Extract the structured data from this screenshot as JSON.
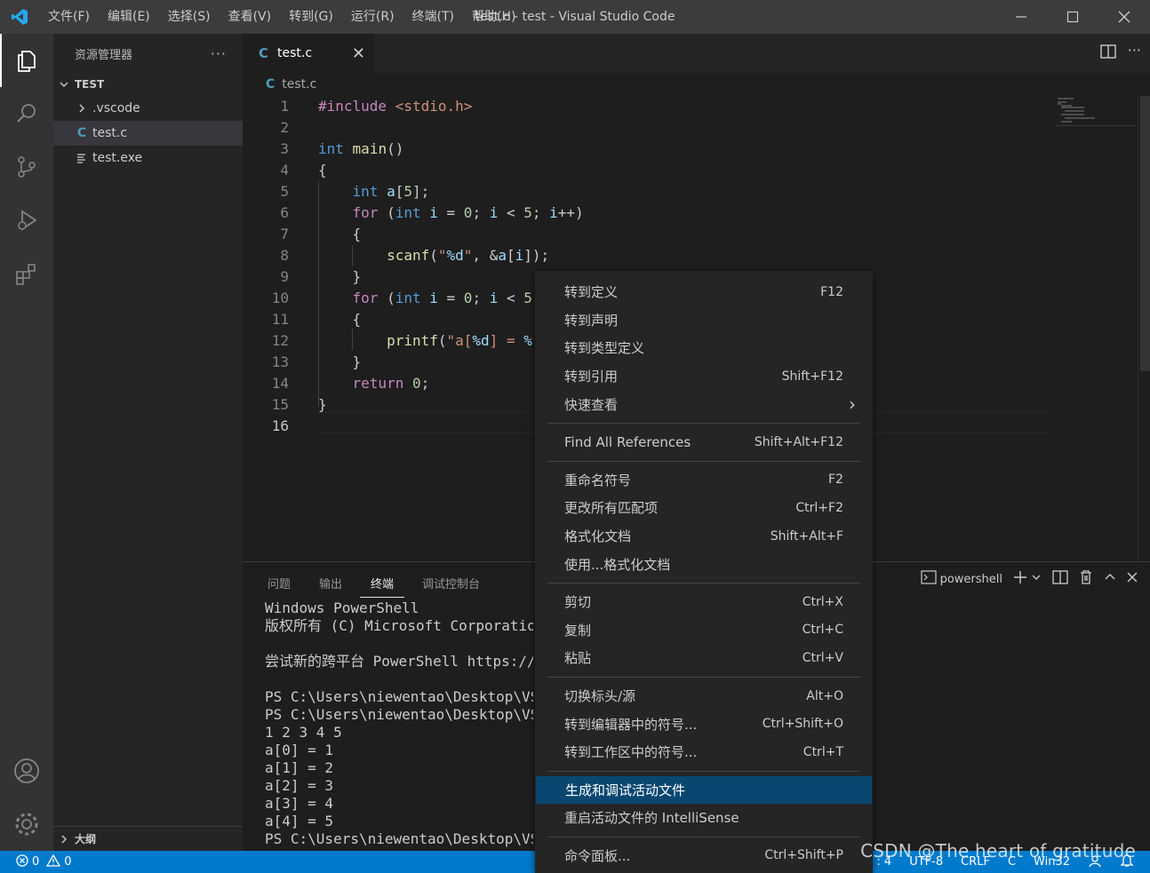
{
  "titlebar": {
    "menus": [
      "文件(F)",
      "编辑(E)",
      "选择(S)",
      "查看(V)",
      "转到(G)",
      "运行(R)",
      "终端(T)",
      "帮助(H)"
    ],
    "title": "test.c - test - Visual Studio Code"
  },
  "activity": {
    "items": [
      "explorer-icon",
      "search-icon",
      "source-control-icon",
      "run-debug-icon",
      "extensions-icon"
    ],
    "bottom": [
      "account-icon",
      "settings-gear-icon"
    ]
  },
  "sidebar": {
    "header": "资源管理器",
    "more": "···",
    "section": "TEST",
    "items": [
      ".vscode",
      "test.c",
      "test.exe"
    ],
    "outline": "大纲"
  },
  "tabs": {
    "active_icon": "C",
    "active_label": "test.c",
    "close": "✕"
  },
  "breadcrumb": {
    "icon": "C",
    "file": "test.c"
  },
  "editor": {
    "line_numbers": [
      "1",
      "2",
      "3",
      "4",
      "5",
      "6",
      "7",
      "8",
      "9",
      "10",
      "11",
      "12",
      "13",
      "14",
      "15",
      "16"
    ],
    "current_line": 16
  },
  "panel": {
    "tabs": [
      "问题",
      "输出",
      "终端",
      "调试控制台"
    ],
    "active_tab": "终端",
    "shell": "powershell",
    "terminal_lines": [
      "Windows PowerShell",
      "版权所有 (C) Microsoft Corporation",
      "",
      "尝试新的跨平台 PowerShell https://",
      "",
      "PS C:\\Users\\niewentao\\Desktop\\VScc",
      "PS C:\\Users\\niewentao\\Desktop\\VScc",
      "1 2 3 4 5",
      "a[0] = 1",
      "a[1] = 2",
      "a[2] = 3",
      "a[3] = 4",
      "a[4] = 5",
      "PS C:\\Users\\niewentao\\Desktop\\VScc"
    ]
  },
  "context_menu": {
    "groups": [
      [
        {
          "label": "转到定义",
          "shortcut": "F12"
        },
        {
          "label": "转到声明",
          "shortcut": ""
        },
        {
          "label": "转到类型定义",
          "shortcut": ""
        },
        {
          "label": "转到引用",
          "shortcut": "Shift+F12"
        },
        {
          "label": "快速查看",
          "shortcut": "›"
        }
      ],
      [
        {
          "label": "Find All References",
          "shortcut": "Shift+Alt+F12"
        }
      ],
      [
        {
          "label": "重命名符号",
          "shortcut": "F2"
        },
        {
          "label": "更改所有匹配项",
          "shortcut": "Ctrl+F2"
        },
        {
          "label": "格式化文档",
          "shortcut": "Shift+Alt+F"
        },
        {
          "label": "使用...格式化文档",
          "shortcut": ""
        }
      ],
      [
        {
          "label": "剪切",
          "shortcut": "Ctrl+X"
        },
        {
          "label": "复制",
          "shortcut": "Ctrl+C"
        },
        {
          "label": "粘贴",
          "shortcut": "Ctrl+V"
        }
      ],
      [
        {
          "label": "切换标头/源",
          "shortcut": "Alt+O"
        },
        {
          "label": "转到编辑器中的符号...",
          "shortcut": "Ctrl+Shift+O"
        },
        {
          "label": "转到工作区中的符号...",
          "shortcut": "Ctrl+T"
        }
      ],
      [
        {
          "label": "生成和调试活动文件",
          "shortcut": ""
        },
        {
          "label": "重启活动文件的 IntelliSense",
          "shortcut": ""
        }
      ],
      [
        {
          "label": "命令面板...",
          "shortcut": "Ctrl+Shift+P"
        }
      ]
    ],
    "highlighted": "生成和调试活动文件"
  },
  "statusbar": {
    "errors": "0",
    "warnings": "0",
    "right": [
      ": 4",
      "UTF-8",
      "CRLF",
      "C",
      "Win32"
    ]
  },
  "watermark": "CSDN @The heart of gratitude",
  "colors": {
    "accent": "#007acc",
    "highlight": "#094771",
    "c_icon": "#519aba"
  }
}
